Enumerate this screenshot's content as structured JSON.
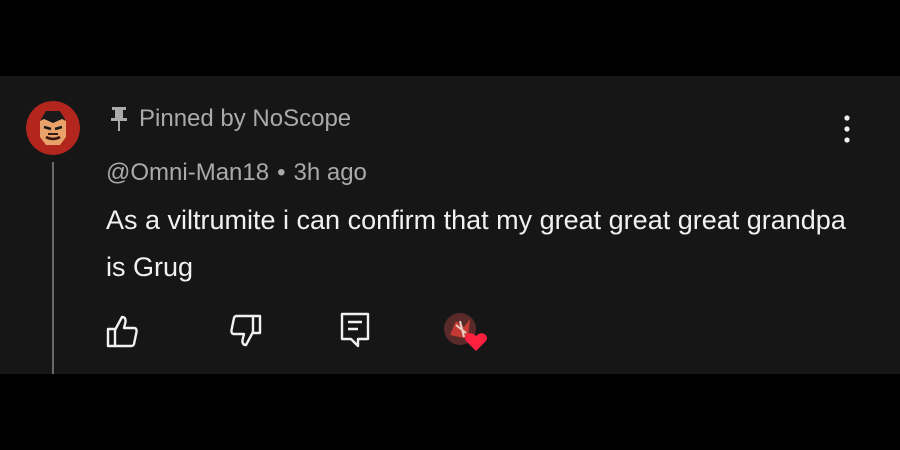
{
  "comment": {
    "pinned_label": "Pinned by NoScope",
    "author": "@Omni-Man18",
    "separator": "•",
    "time": "3h ago",
    "text": "As a viltrumite i can confirm that my great great great grandpa is Grug"
  },
  "icons": {
    "pin": "pin-icon",
    "more": "more-vert-icon",
    "like": "thumbs-up-icon",
    "dislike": "thumbs-down-icon",
    "reply": "comment-reply-icon",
    "creator_heart": "creator-heart-icon"
  },
  "colors": {
    "background": "#000000",
    "panel": "#161616",
    "text_primary": "#f1f1f1",
    "text_secondary": "#aaaaaa",
    "heart": "#ff2040"
  }
}
